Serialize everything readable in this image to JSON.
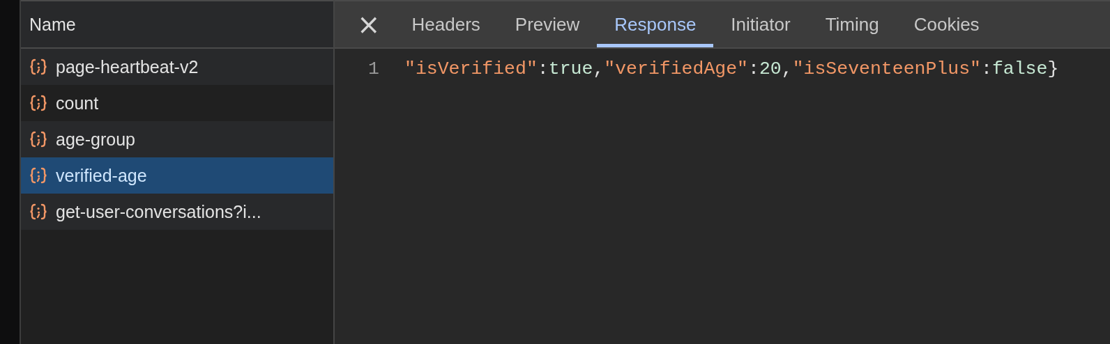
{
  "requests": {
    "column_title": "Name",
    "items": [
      {
        "name": "page-heartbeat-v2",
        "selected": false
      },
      {
        "name": "count",
        "selected": false
      },
      {
        "name": "age-group",
        "selected": false
      },
      {
        "name": "verified-age",
        "selected": true
      },
      {
        "name": "get-user-conversations?i...",
        "selected": false
      }
    ]
  },
  "detail": {
    "close": "×",
    "tabs": [
      {
        "label": "Headers",
        "selected": false
      },
      {
        "label": "Preview",
        "selected": false
      },
      {
        "label": "Response",
        "selected": true
      },
      {
        "label": "Initiator",
        "selected": false
      },
      {
        "label": "Timing",
        "selected": false
      },
      {
        "label": "Cookies",
        "selected": false
      }
    ],
    "lines": [
      {
        "number": "1",
        "tokens": [
          {
            "kind": "string",
            "text": "\"isVerified\""
          },
          {
            "kind": "punct",
            "text": ":"
          },
          {
            "kind": "literal",
            "text": "true"
          },
          {
            "kind": "punct",
            "text": ","
          },
          {
            "kind": "string",
            "text": "\"verifiedAge\""
          },
          {
            "kind": "punct",
            "text": ":"
          },
          {
            "kind": "literal",
            "text": "20"
          },
          {
            "kind": "punct",
            "text": ","
          },
          {
            "kind": "string",
            "text": "\"isSeventeenPlus\""
          },
          {
            "kind": "punct",
            "text": ":"
          },
          {
            "kind": "literal",
            "text": "false"
          },
          {
            "kind": "punct",
            "text": "}"
          }
        ]
      }
    ]
  }
}
